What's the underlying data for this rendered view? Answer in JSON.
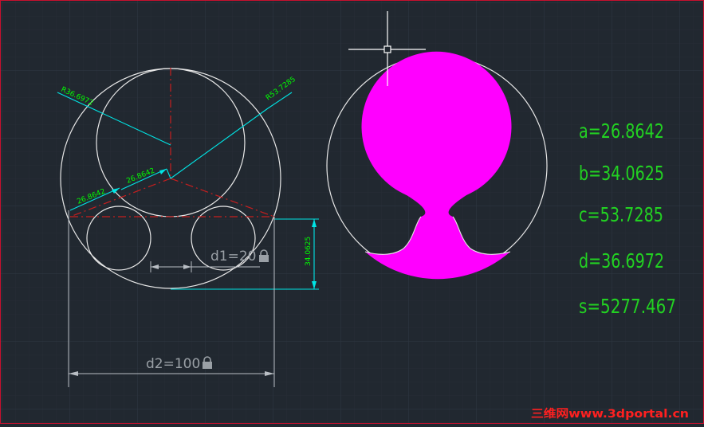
{
  "colors": {
    "background": "#212830",
    "grid_minor": "#262d36",
    "grid_major": "#2d3540",
    "geometry": "#e8e8e8",
    "centerline": "#c81e1e",
    "dimension": "#00e5e5",
    "dim_text": "#00ff00",
    "result_text": "#22d122",
    "fill": "#ff00ff",
    "watermark": "#ff2020",
    "frame": "#c8102e"
  },
  "dimensions": {
    "radius_outer": "R53.7285",
    "radius_inner": "R36.6972",
    "offset_left": "26.8642",
    "offset_center": "26.8642",
    "height": "34.0625",
    "d1": "d1=20",
    "d2": "d2=100",
    "lock_icon": "lock-icon"
  },
  "results": {
    "a": "a=26.8642",
    "b": "b=34.0625",
    "c": "c=53.7285",
    "d": "d=36.6972",
    "s": "s=5277.467"
  },
  "watermark": "三维网www.3dportal.cn"
}
